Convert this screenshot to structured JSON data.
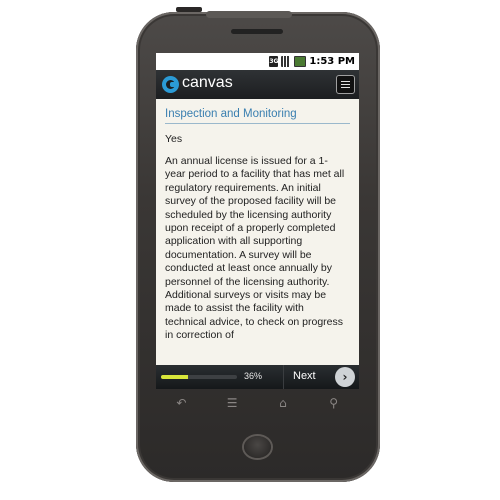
{
  "status_bar": {
    "time": "1:53 PM",
    "network_label": "3G",
    "icons": [
      "3g-icon",
      "signal-bars-icon",
      "battery-icon"
    ]
  },
  "app_bar": {
    "app_name": "canvas",
    "logo_icon": "canvas-logo-icon",
    "menu_icon": "menu-icon"
  },
  "content": {
    "title": "Inspection and Monitoring",
    "answer": "Yes",
    "body": "An annual license is issued for a 1-year period to a facility that has met all regulatory requirements. An initial survey of the proposed facility will be scheduled by the licensing authority upon receipt of a properly completed application with all supporting documentation. A survey will be conducted at least once annually by personnel of the licensing authority. Additional surveys or visits may be made to assist the facility with technical advice, to check on progress in correction of"
  },
  "bottom_bar": {
    "progress": 0.36,
    "progress_label": "36%",
    "next_label": "Next",
    "next_icon": "chevron-right-icon"
  },
  "soft_keys": {
    "icons": [
      "back-icon",
      "menu-key-icon",
      "home-key-icon",
      "search-key-icon"
    ],
    "glyphs": {
      "back": "↶",
      "menu": "☰",
      "home": "⌂",
      "search": "⚲"
    }
  },
  "colors": {
    "accent": "#2b9bd6",
    "title_blue": "#3a7fb0",
    "progress_fill": "#d8e63a",
    "content_bg": "#f5f3ec"
  }
}
